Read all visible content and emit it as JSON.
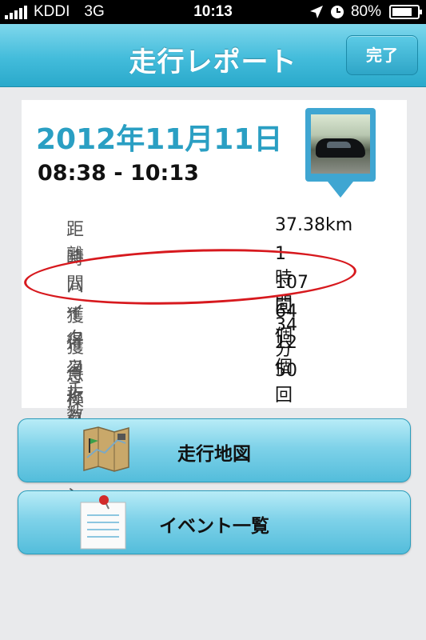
{
  "status_bar": {
    "carrier": "KDDI",
    "network": "3G",
    "time": "10:13",
    "battery": "80%",
    "icons": [
      "signal-icon",
      "location-arrow-icon",
      "clock-icon",
      "battery-icon"
    ]
  },
  "nav": {
    "title": "走行レポート",
    "done_label": "完了"
  },
  "report": {
    "date": "2012年11月11日",
    "time_range": "08:38 - 10:13",
    "stats": [
      {
        "label": "距離",
        "value": "37.38km"
      },
      {
        "label": "時間",
        "value": "1時間34分"
      },
      {
        "label": "ハイタッチ数",
        "value": "107回"
      },
      {
        "label": "獲得コレクション",
        "value": "64個"
      },
      {
        "label": "獲得称号",
        "value": "12個"
      },
      {
        "label": "急操作",
        "value": "50回"
      }
    ]
  },
  "buttons": {
    "map_label": "走行地図",
    "events_label": "イベント一覧"
  },
  "colors": {
    "accent": "#43bcdb",
    "date_text": "#2a9fc3",
    "highlight": "#d7191e"
  }
}
